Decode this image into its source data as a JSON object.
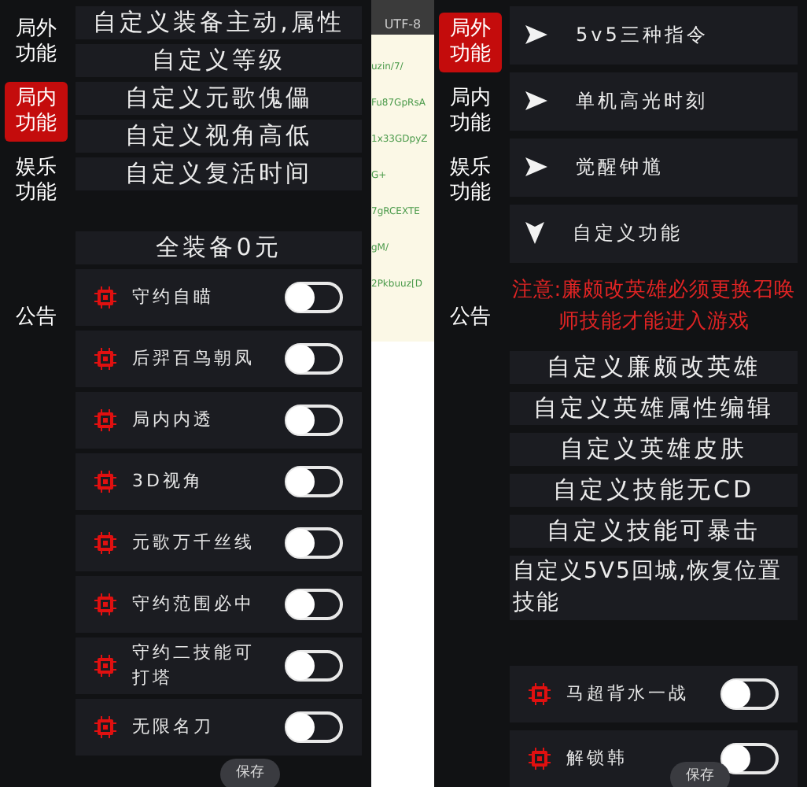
{
  "panels": [
    {
      "sidebar": {
        "items": [
          {
            "label": "局外功能",
            "selected": false
          },
          {
            "label": "局内功能",
            "selected": true
          },
          {
            "label": "娱乐功能",
            "selected": false
          }
        ],
        "announcement": "公告"
      },
      "content": [
        {
          "kind": "button",
          "label": "自定义装备主动,属性"
        },
        {
          "kind": "button",
          "label": "自定义等级"
        },
        {
          "kind": "button",
          "label": "自定义元歌傀儡"
        },
        {
          "kind": "button",
          "label": "自定义视角高低"
        },
        {
          "kind": "button",
          "label": "自定义复活时间"
        },
        {
          "kind": "spacer"
        },
        {
          "kind": "button",
          "label": "全装备0元"
        },
        {
          "kind": "toggle",
          "label": "守约自瞄",
          "on": false
        },
        {
          "kind": "toggle",
          "label": "后羿百鸟朝凤",
          "on": false
        },
        {
          "kind": "toggle",
          "label": "局内内透",
          "on": false
        },
        {
          "kind": "toggle",
          "label": "3D视角",
          "on": false
        },
        {
          "kind": "toggle",
          "label": "元歌万千丝线",
          "on": false
        },
        {
          "kind": "toggle",
          "label": "守约范围必中",
          "on": false
        },
        {
          "kind": "toggle",
          "label": "守约二技能可打塔",
          "on": false
        },
        {
          "kind": "toggle",
          "label": "无限名刀",
          "on": false
        }
      ],
      "save": "保存"
    },
    {
      "sidebar": {
        "items": [
          {
            "label": "局外功能",
            "selected": true
          },
          {
            "label": "局内功能",
            "selected": false
          },
          {
            "label": "娱乐功能",
            "selected": false
          }
        ],
        "announcement": "公告"
      },
      "content": [
        {
          "kind": "expander",
          "label": "5v5三种指令",
          "expanded": false
        },
        {
          "kind": "expander",
          "label": "单机高光时刻",
          "expanded": false
        },
        {
          "kind": "expander",
          "label": "觉醒钟馗",
          "expanded": false
        },
        {
          "kind": "expander",
          "label": "自定义功能",
          "expanded": true
        },
        {
          "kind": "notice",
          "label": "注意:廉颇改英雄必须更换召唤师技能才能进入游戏"
        },
        {
          "kind": "button",
          "label": "自定义廉颇改英雄"
        },
        {
          "kind": "button",
          "label": "自定义英雄属性编辑"
        },
        {
          "kind": "button",
          "label": "自定义英雄皮肤"
        },
        {
          "kind": "button",
          "label": "自定义技能无CD"
        },
        {
          "kind": "button",
          "label": "自定义技能可暴击"
        },
        {
          "kind": "wide-button",
          "label": "自定义5V5回城,恢复位置技能"
        },
        {
          "kind": "spacer"
        },
        {
          "kind": "toggle",
          "label": "马超背水一战",
          "on": false
        },
        {
          "kind": "toggle",
          "label": "解锁韩",
          "on": false
        }
      ],
      "save": "保存"
    }
  ],
  "background_page": {
    "encoding": "UTF-8",
    "lines": [
      "uzin/7/",
      "Fu87GpRsA",
      "1x33GDpyZ",
      "G+",
      "7gRCEXTE",
      "gM/",
      "2Pkbuuz[D"
    ]
  }
}
